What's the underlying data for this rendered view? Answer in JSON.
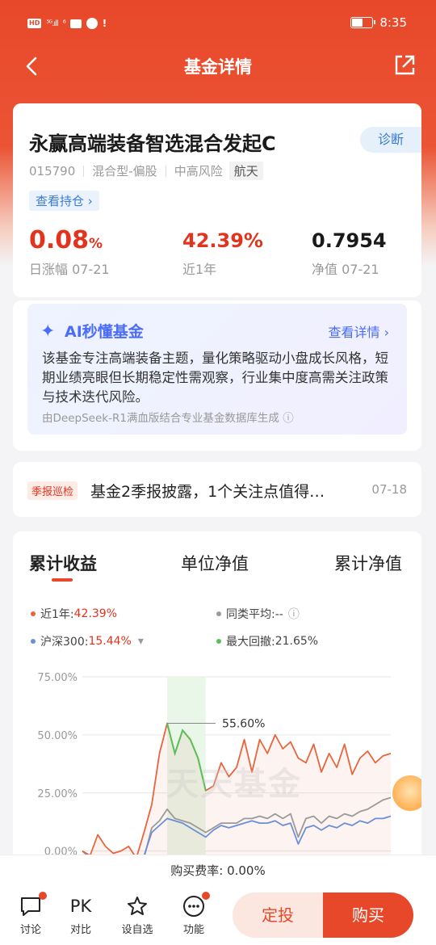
{
  "status_bar": {
    "hd_badge": "HD",
    "signal": "⁵ᴳ.ıll",
    "wifi": "⁶",
    "alert": "!",
    "battery_level": 0.55,
    "time": "8:35"
  },
  "nav": {
    "title": "基金详情"
  },
  "fund": {
    "name": "永赢高端装备智选混合发起C",
    "diagnose_label": "诊断",
    "code": "015790",
    "type": "混合型-偏股",
    "risk": "中高风险",
    "tag": "航天",
    "holdings_label": "查看持仓 ›",
    "stats": [
      {
        "value": "0.08",
        "unit": "%",
        "label": "日涨幅 07-21"
      },
      {
        "value": "42.39%",
        "unit": "",
        "label": "近1年"
      },
      {
        "value": "0.7954",
        "unit": "",
        "label": "净值 07-21"
      }
    ]
  },
  "ai": {
    "title": "AI秒懂基金",
    "more_label": "查看详情 ›",
    "text": "该基金专注高端装备主题，量化策略驱动小盘成长风格，短期业绩亮眼但长期稳定性需观察，行业集中度高需关注政策与技术迭代风险。",
    "footer": "由DeepSeek-R1满血版结合专业基金数据库生成 ⓘ"
  },
  "report": {
    "tag": "季报巡检",
    "text": "基金2季报披露，1个关注点值得…",
    "date": "07-18"
  },
  "chart_tabs": [
    "累计收益",
    "单位净值",
    "累计净值"
  ],
  "legend": {
    "fund_label": "近1年:",
    "fund_value": "42.39%",
    "peer_label": "同类平均:--",
    "peer_info": "ⓘ",
    "index_label": "沪深300:",
    "index_value": "15.44%",
    "index_dropdown": "▾",
    "drawdown_label": "最大回撤:",
    "drawdown_value": "21.65%"
  },
  "watermark": "天天基金",
  "chart_data": {
    "type": "line",
    "y_ticks": [
      "75.00%",
      "50.00%",
      "25.00%",
      "0.00%"
    ],
    "ylim": [
      -5,
      75
    ],
    "x": [
      0,
      1,
      2,
      3,
      4,
      5,
      6,
      7,
      8,
      9,
      10,
      11,
      12,
      13,
      14,
      15,
      16,
      17,
      18,
      19,
      20,
      21,
      22,
      23,
      24,
      25,
      26,
      27,
      28,
      29,
      30,
      31,
      32,
      33,
      34,
      35,
      36,
      37,
      38,
      39,
      40
    ],
    "series": [
      {
        "name": "近1年",
        "color": "#e8643c",
        "values": [
          0,
          -2,
          7,
          2,
          -1,
          0,
          2,
          -3,
          8,
          20,
          42,
          55,
          42,
          52,
          48,
          40,
          26,
          28,
          38,
          32,
          36,
          48,
          34,
          48,
          42,
          50,
          44,
          47,
          40,
          38,
          46,
          34,
          42,
          36,
          46,
          33,
          40,
          43,
          38,
          41,
          42
        ]
      },
      {
        "name": "沪深300",
        "color": "#6a8fd8",
        "values": [
          0,
          -3,
          -4,
          -6,
          -5,
          -4,
          -5,
          -3,
          -2,
          8,
          11,
          14,
          13,
          12,
          10,
          8,
          6,
          9,
          11,
          10,
          11,
          12,
          13,
          12,
          12,
          13,
          11,
          12,
          3,
          10,
          11,
          9,
          11,
          10,
          12,
          11,
          13,
          12,
          14,
          14,
          15
        ]
      },
      {
        "name": "同类平均",
        "color": "#9a9a9a",
        "values": [
          0,
          -2,
          -4,
          -5,
          -6,
          -4,
          -5,
          -4,
          -3,
          10,
          13,
          18,
          14,
          13,
          12,
          10,
          8,
          10,
          12,
          12,
          12,
          14,
          14,
          15,
          14,
          16,
          14,
          16,
          6,
          14,
          15,
          12,
          15,
          14,
          16,
          15,
          17,
          18,
          20,
          22,
          23
        ]
      }
    ],
    "drawdown_range": [
      11,
      16
    ],
    "peak_annotation": "55.60%",
    "peak_index": 11
  },
  "fee": {
    "text": "购买费率: 0.00%"
  },
  "bottom_bar": {
    "discuss": "讨论",
    "pk_icon": "PK",
    "pk": "对比",
    "watchlist": "设自选",
    "functions": "功能",
    "sip": "定投",
    "buy": "购买"
  }
}
